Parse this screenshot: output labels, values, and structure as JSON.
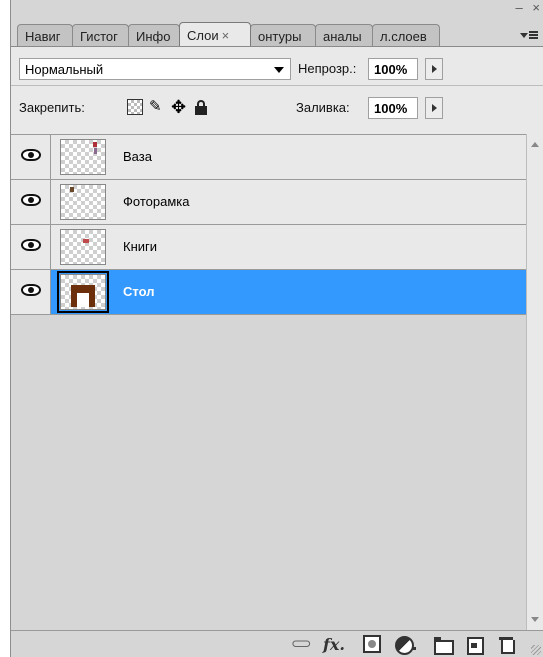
{
  "window": {
    "minimize_glyph": "–",
    "close_glyph": "×"
  },
  "tabs": [
    {
      "label": "Навиг"
    },
    {
      "label": "Гистог"
    },
    {
      "label": "Инфо"
    },
    {
      "label": "Слои",
      "active": true,
      "close": "×"
    },
    {
      "label": "онтуры"
    },
    {
      "label": "аналы"
    },
    {
      "label": "л.слоев"
    }
  ],
  "blend": {
    "mode": "Нормальный",
    "opacity_label": "Непрозр.:",
    "opacity_value": "100%"
  },
  "lock": {
    "label": "Закрепить:",
    "fill_label": "Заливка:",
    "fill_value": "100%"
  },
  "layers": [
    {
      "name": "Ваза",
      "visible": true,
      "selected": false
    },
    {
      "name": "Фоторамка",
      "visible": true,
      "selected": false
    },
    {
      "name": "Книги",
      "visible": true,
      "selected": false
    },
    {
      "name": "Стол",
      "visible": true,
      "selected": true
    }
  ],
  "toolbar": {
    "icons": [
      "link-icon",
      "fx-icon",
      "mask-icon",
      "adjustment-icon",
      "folder-icon",
      "new-layer-icon",
      "trash-icon"
    ],
    "fx_label": "fx"
  },
  "colors": {
    "selection": "#3399ff",
    "panel": "#d6d6d6",
    "table_thumb": "#6b2f0c"
  }
}
